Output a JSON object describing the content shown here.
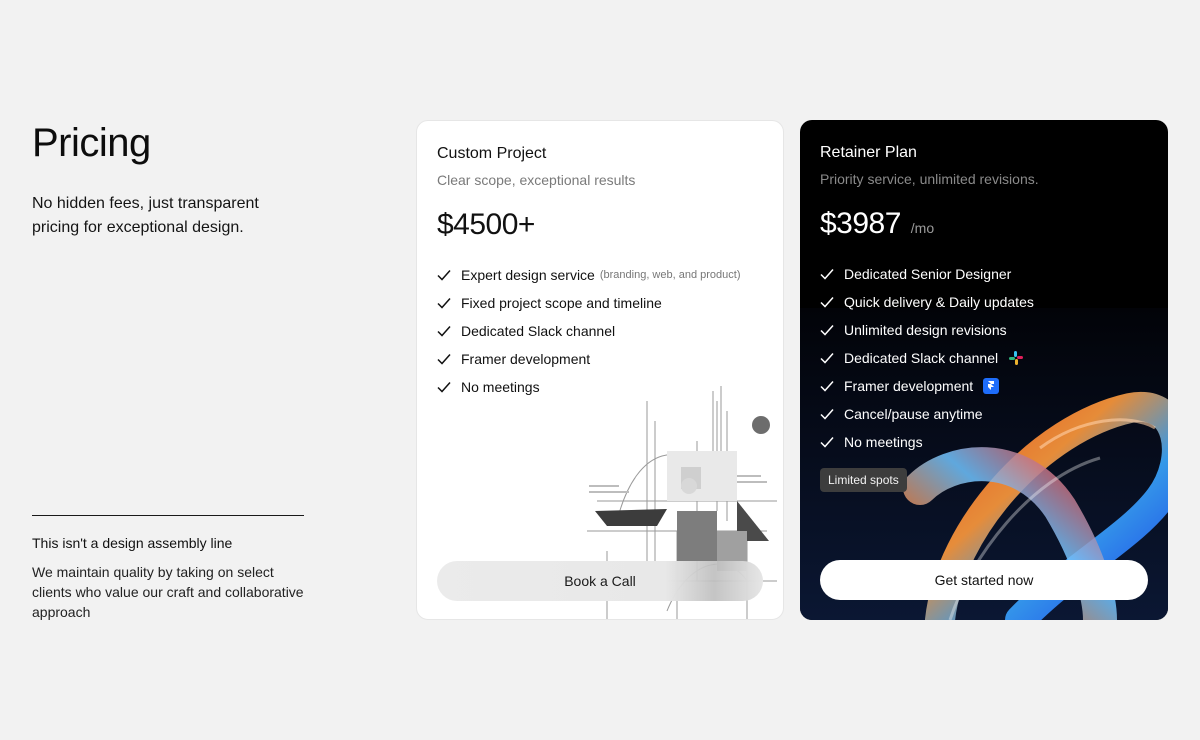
{
  "intro": {
    "title": "Pricing",
    "lead": "No hidden fees, just transparent pricing for exceptional design."
  },
  "note": {
    "heading": "This isn't a design assembly line",
    "body": "We maintain quality by taking on select clients who value our craft and collaborative approach"
  },
  "plans": [
    {
      "title": "Custom Project",
      "subtitle": "Clear scope, exceptional results",
      "price": "$4500+",
      "features": [
        {
          "label": "Expert design service",
          "note": "(branding, web, and product)"
        },
        {
          "label": "Fixed project scope and timeline"
        },
        {
          "label": "Dedicated Slack channel"
        },
        {
          "label": "Framer development"
        },
        {
          "label": "No meetings"
        }
      ],
      "cta": "Book a Call"
    },
    {
      "title": "Retainer Plan",
      "subtitle": "Priority service, unlimited revisions.",
      "price": "$3987",
      "price_period": "/mo",
      "features": [
        {
          "label": "Dedicated Senior Designer"
        },
        {
          "label": "Quick delivery & Daily updates"
        },
        {
          "label": "Unlimited design revisions"
        },
        {
          "label": "Dedicated Slack channel",
          "icon": "slack-icon"
        },
        {
          "label": "Framer development",
          "icon": "framer-icon"
        },
        {
          "label": "Cancel/pause anytime"
        },
        {
          "label": "No meetings"
        }
      ],
      "badge": "Limited spots",
      "cta": "Get started now"
    }
  ],
  "colors": {
    "page_bg": "#f2f2f2",
    "dark_card_bg": "#000000",
    "badge_bg": "#3d3d3d",
    "framer_blue": "#1e6dfb"
  }
}
